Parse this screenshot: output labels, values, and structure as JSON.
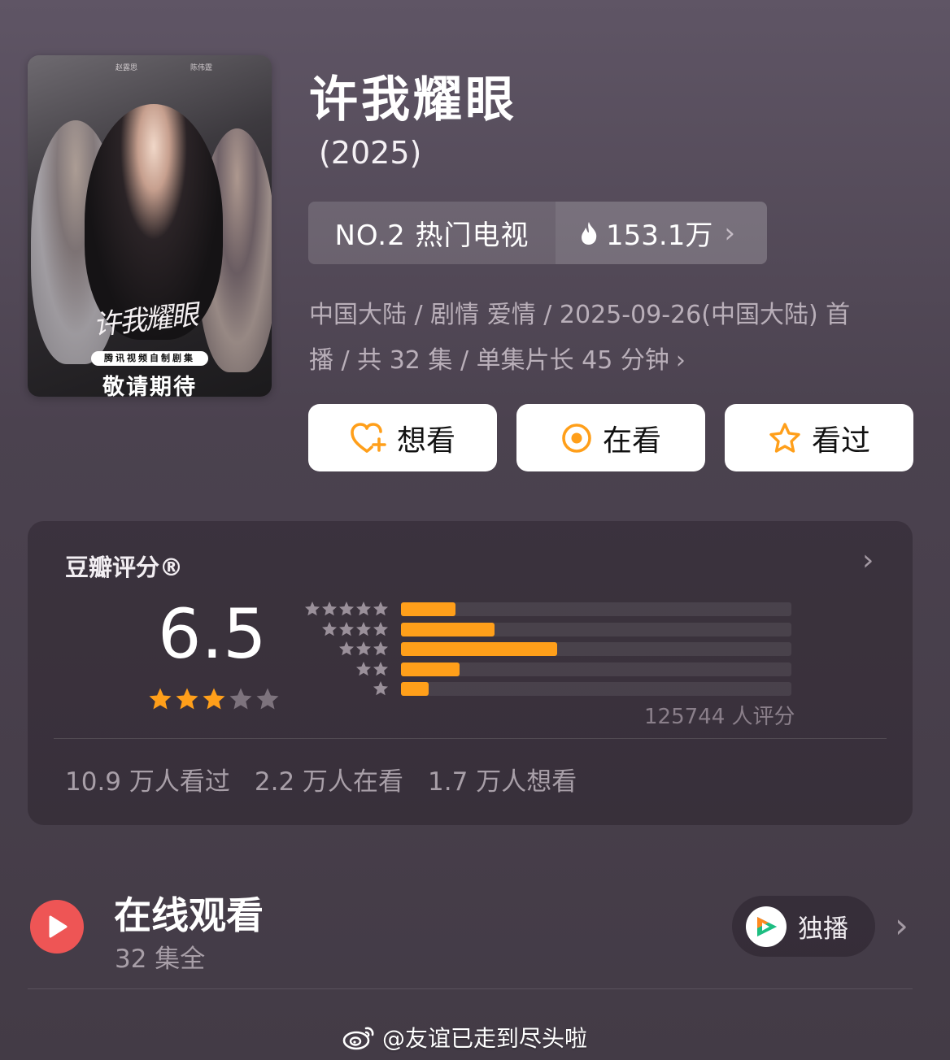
{
  "poster": {
    "credits": [
      "赵露思",
      "陈伟霆"
    ],
    "calligraphy": "许我耀眼",
    "badge": "腾讯视频自制剧集",
    "await": "敬请期待"
  },
  "title": "许我耀眼",
  "year": "(2025)",
  "rank": {
    "label": "NO.2 热门电视",
    "heat": "153.1万"
  },
  "meta": {
    "line1": "中国大陆 / 剧情 爱情 / 2025-09-26(中国大陆) 首",
    "line2": "播 / 共 32 集 / 单集片长 45 分钟"
  },
  "actions": {
    "want": "想看",
    "watching": "在看",
    "watched": "看过"
  },
  "rating": {
    "title": "豆瓣评分®",
    "score": "6.5",
    "stars_filled": 3,
    "stars_total": 5,
    "distribution": [
      {
        "stars": 5,
        "fraction": 0.14
      },
      {
        "stars": 4,
        "fraction": 0.24
      },
      {
        "stars": 3,
        "fraction": 0.4
      },
      {
        "stars": 2,
        "fraction": 0.15
      },
      {
        "stars": 1,
        "fraction": 0.07
      }
    ],
    "count": "125744 人评分",
    "stats": [
      "10.9 万人看过",
      "2.2 万人在看",
      "1.7 万人想看"
    ]
  },
  "online": {
    "title": "在线观看",
    "episodes": "32 集全",
    "exclusive": "独播"
  },
  "watermark": "@友谊已走到尽头啦",
  "colors": {
    "accent": "#ff9f1a",
    "play": "#ee5555"
  }
}
